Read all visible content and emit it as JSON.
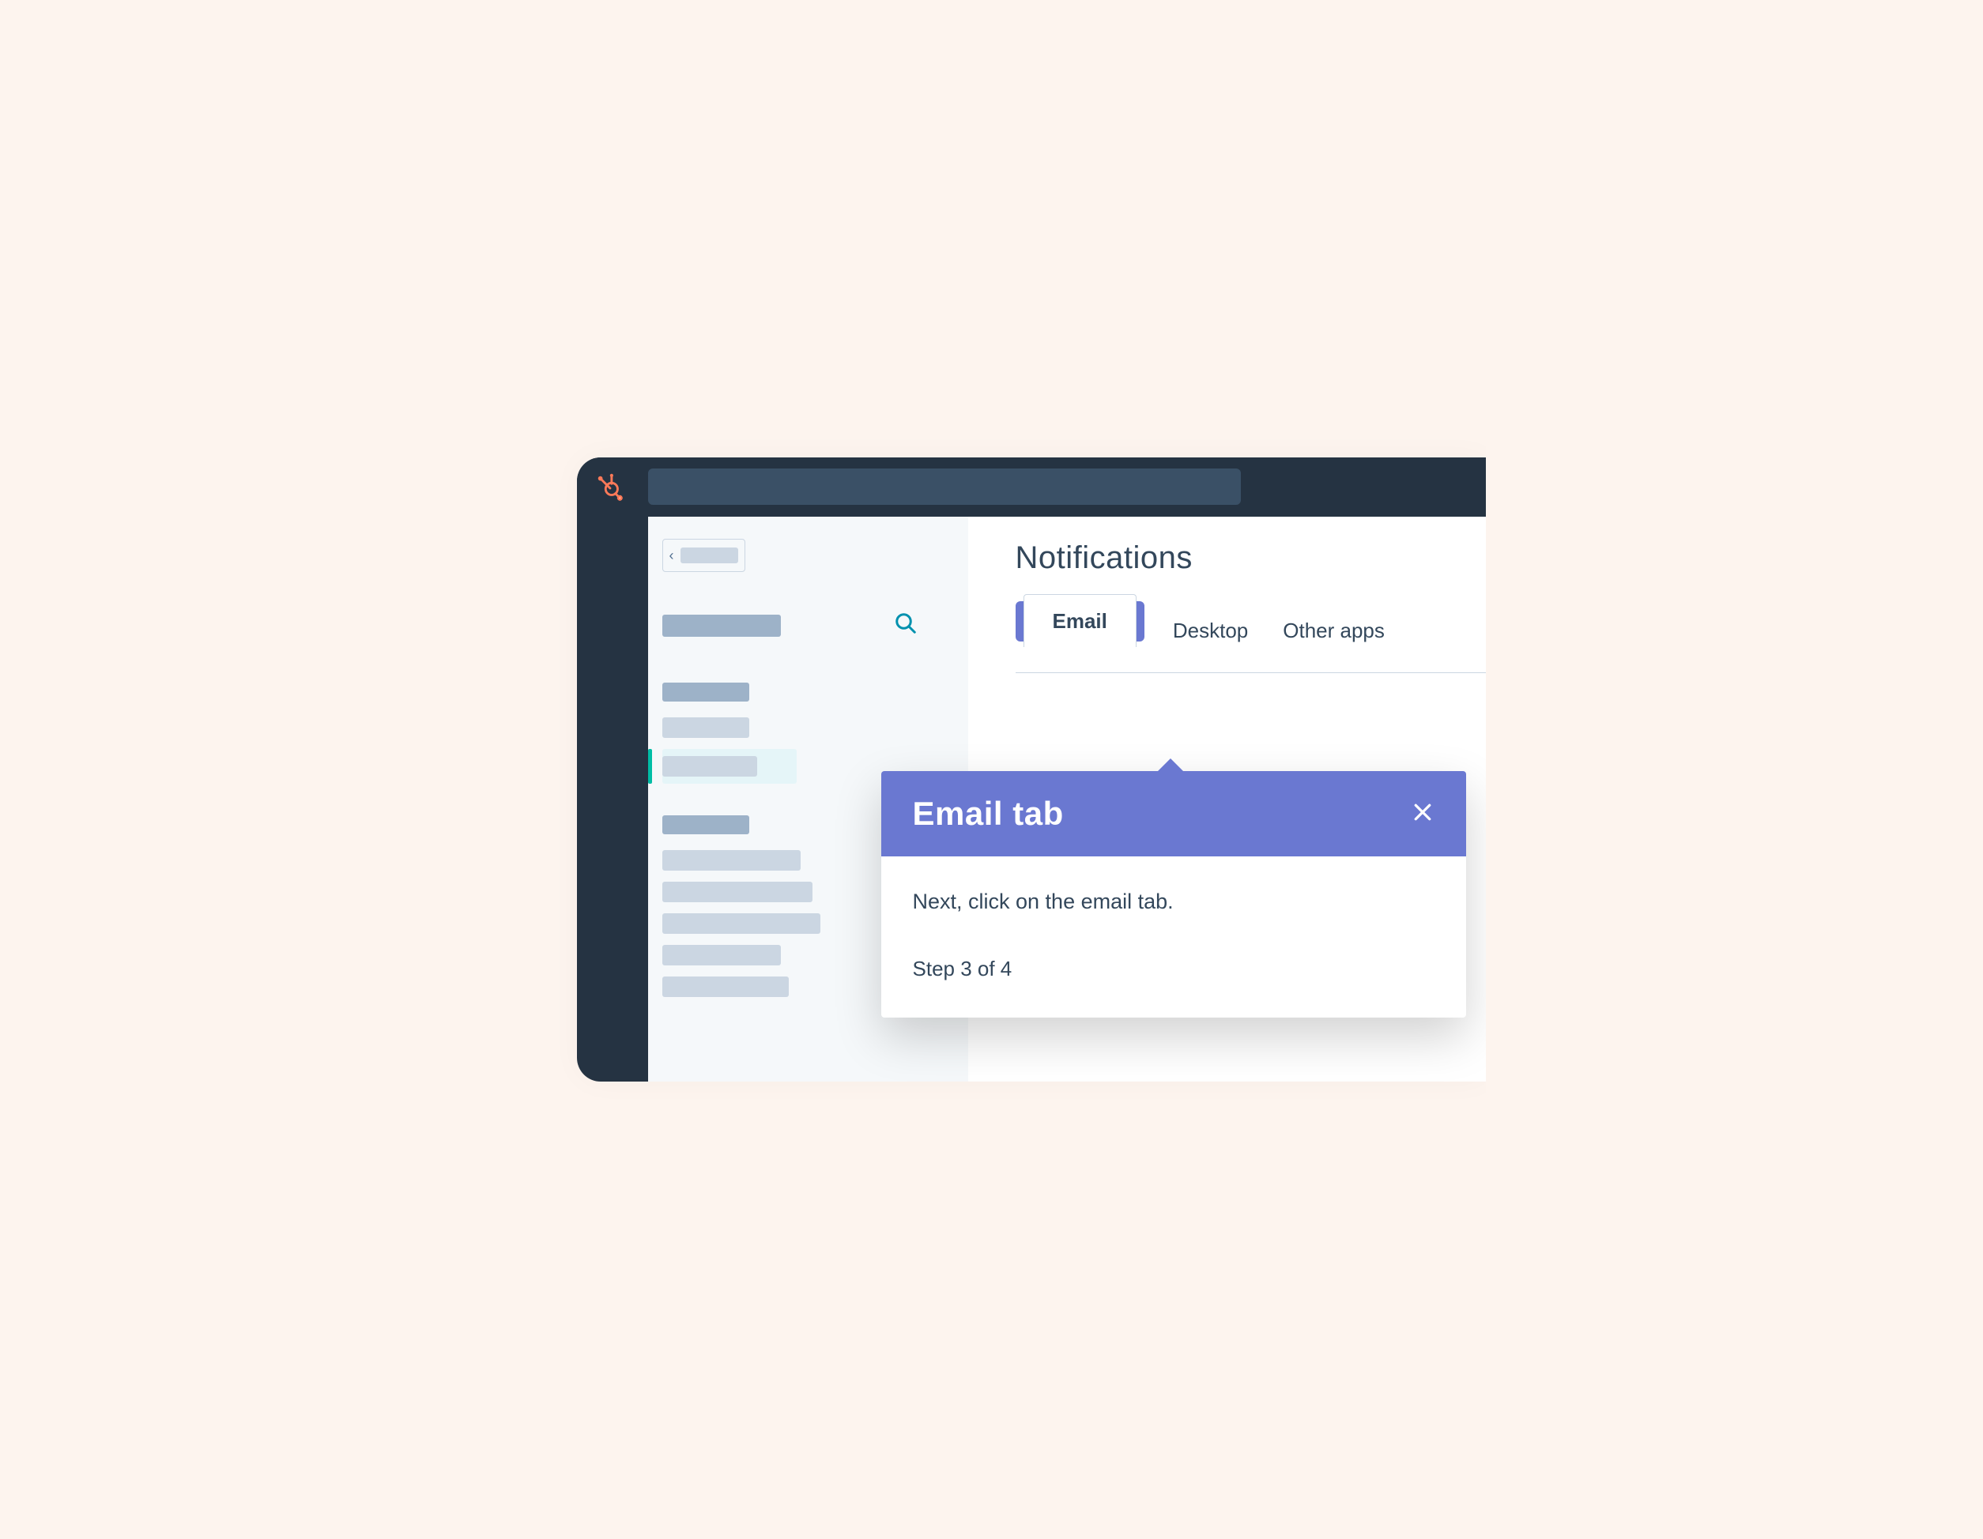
{
  "main": {
    "title": "Notifications",
    "tabs": [
      {
        "id": "email",
        "label": "Email",
        "highlighted": true
      },
      {
        "id": "desktop",
        "label": "Desktop",
        "highlighted": false
      },
      {
        "id": "other",
        "label": "Other apps",
        "highlighted": false
      }
    ]
  },
  "coachmark": {
    "title": "Email tab",
    "body": "Next, click on the email tab.",
    "step_label": "Step 3 of 4",
    "step_current": 3,
    "step_total": 4
  },
  "colors": {
    "chrome": "#253342",
    "accent": "#6a78d1",
    "teal": "#00bda5",
    "text": "#33475b",
    "brand": "#ff7a59"
  }
}
